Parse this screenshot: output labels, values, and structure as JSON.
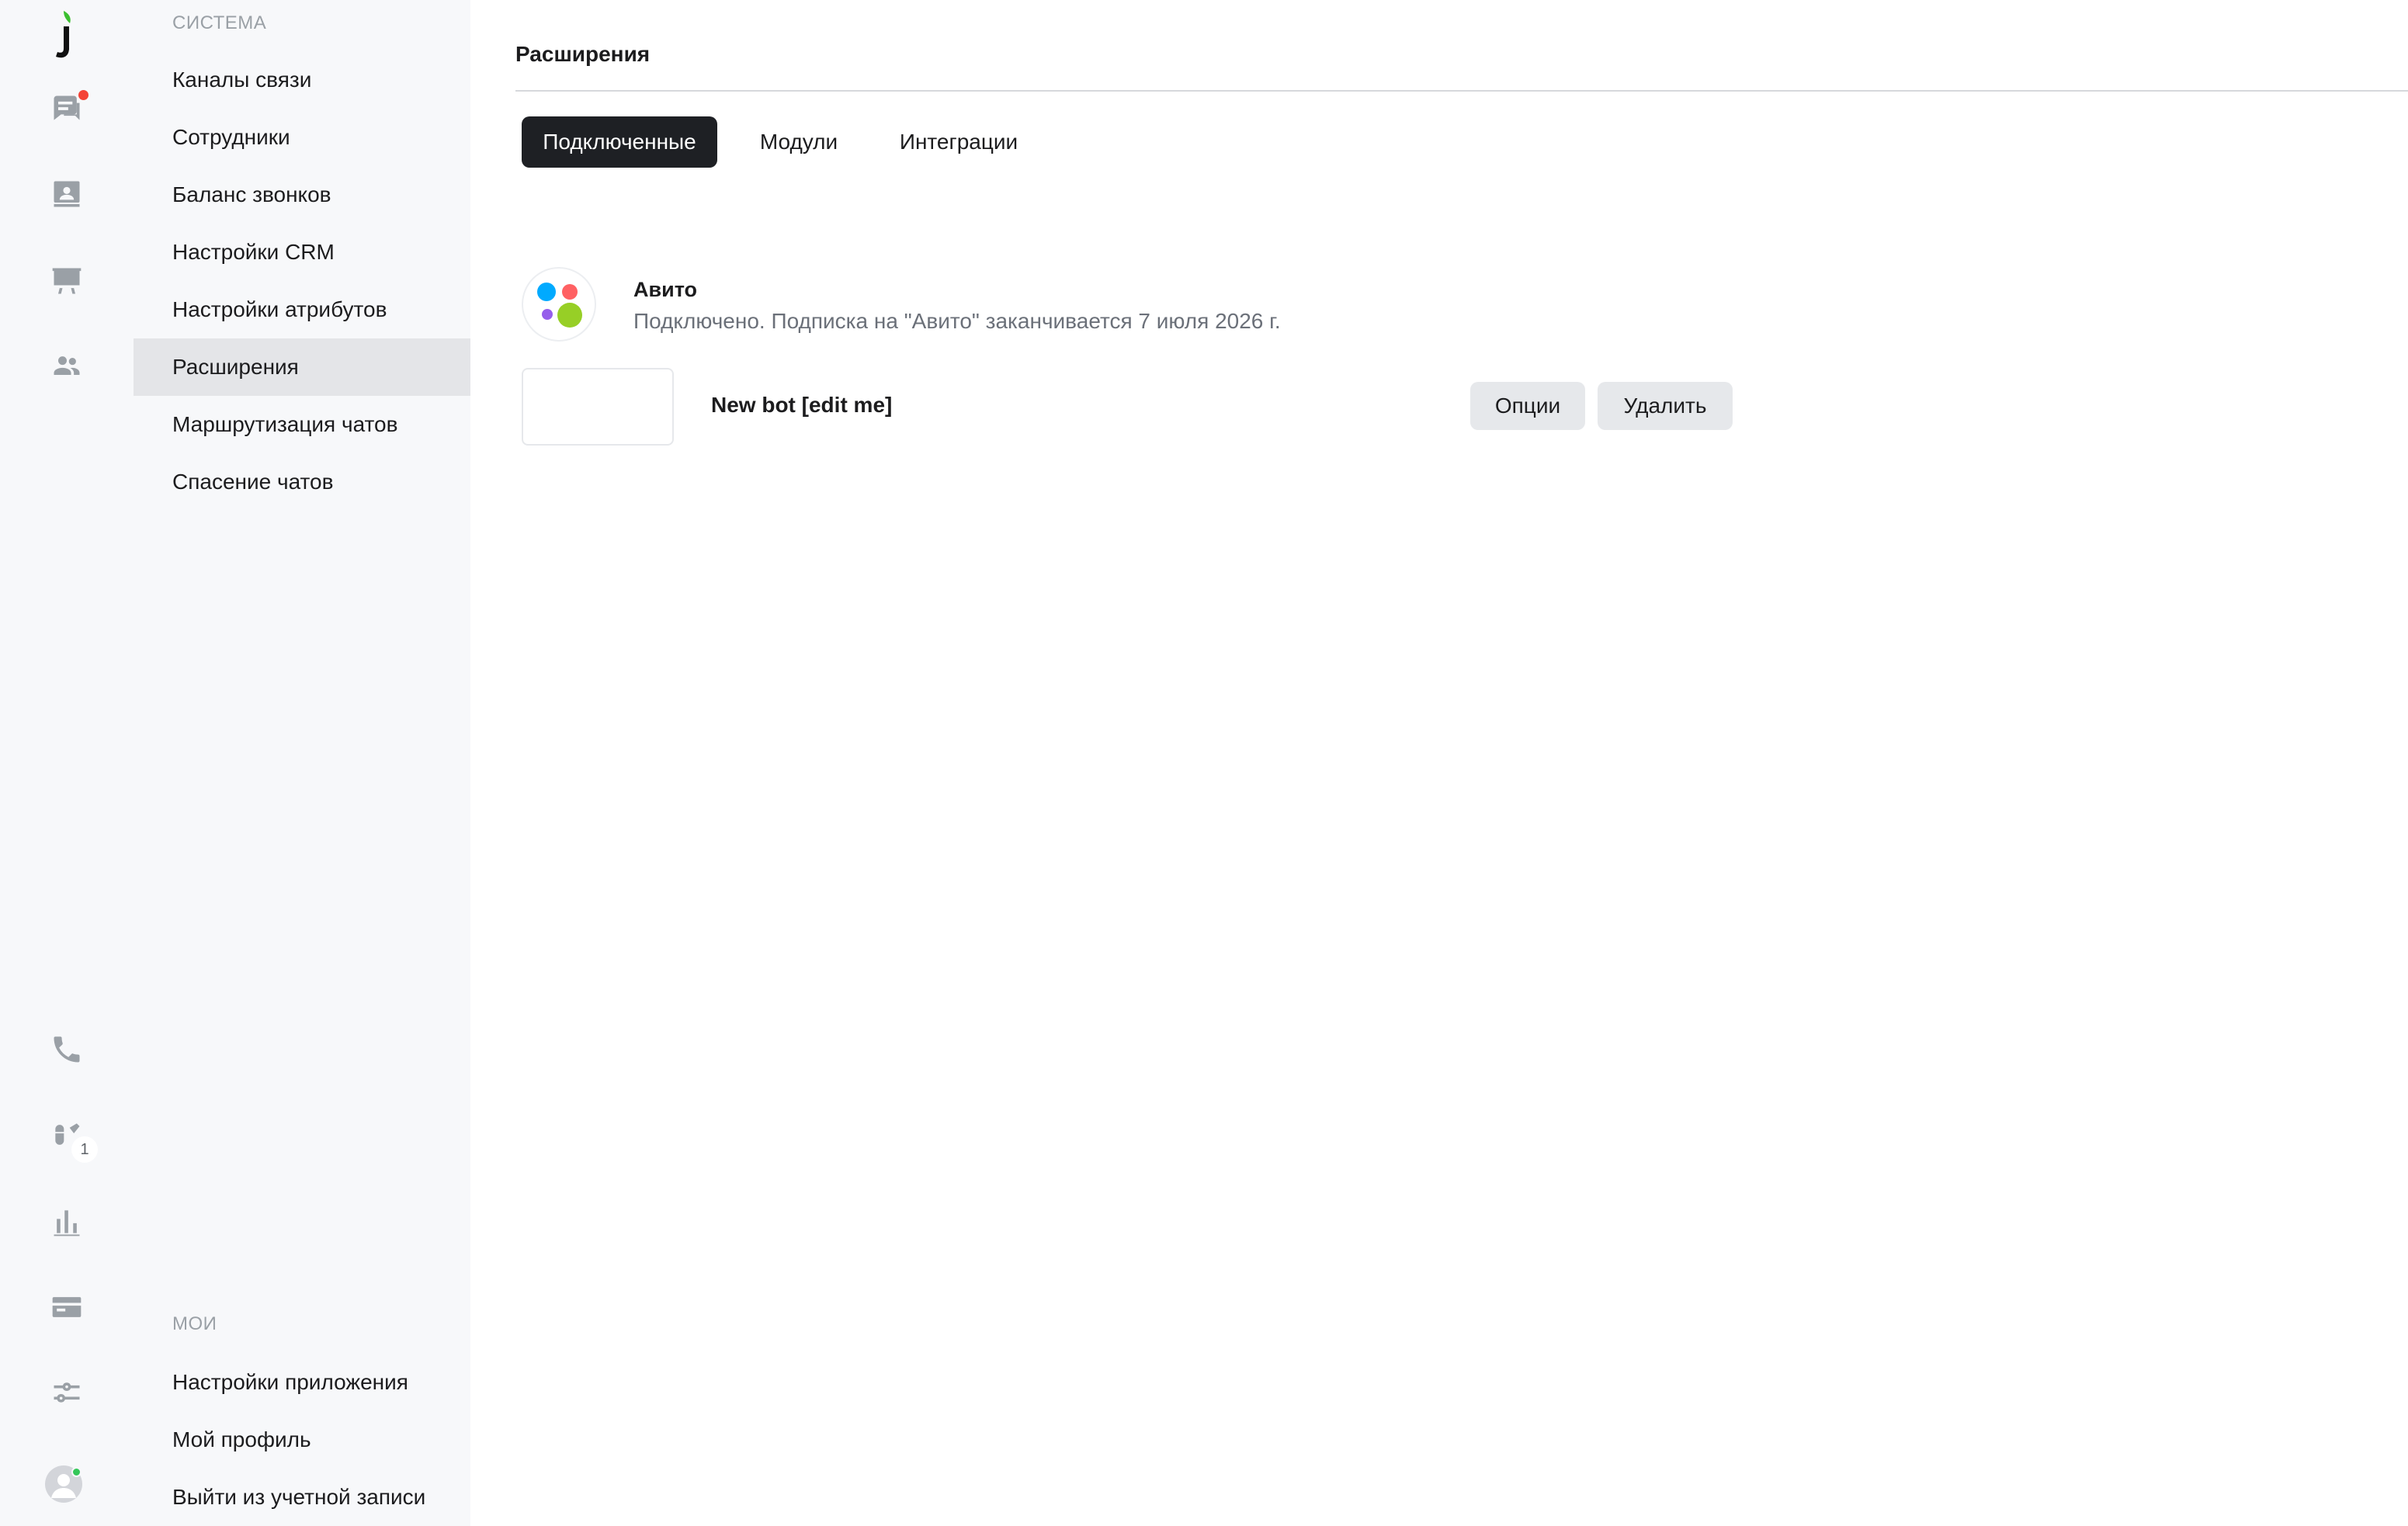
{
  "rail": {
    "top_icons": [
      "chat-icon",
      "contacts-icon",
      "presentation-icon",
      "team-icon"
    ],
    "bottom_icons": [
      "phone-icon",
      "bots-icon",
      "bar-chart-icon",
      "card-icon",
      "sliders-icon"
    ],
    "bots_count": "1"
  },
  "menu": {
    "system_heading": "СИСТЕМА",
    "system_items": [
      {
        "label": "Каналы связи"
      },
      {
        "label": "Сотрудники"
      },
      {
        "label": "Баланс звонков"
      },
      {
        "label": "Настройки CRM"
      },
      {
        "label": "Настройки атрибутов"
      },
      {
        "label": "Расширения",
        "active": true
      },
      {
        "label": "Маршрутизация чатов"
      },
      {
        "label": "Спасение чатов"
      }
    ],
    "my_heading": "МОИ",
    "my_items": [
      {
        "label": "Настройки приложения"
      },
      {
        "label": "Мой профиль"
      },
      {
        "label": "Выйти из учетной записи"
      }
    ]
  },
  "main": {
    "title": "Расширения",
    "tabs": [
      {
        "label": "Подключенные",
        "active": true
      },
      {
        "label": "Модули"
      },
      {
        "label": "Интеграции"
      }
    ],
    "extensions": [
      {
        "name": "Авито",
        "status": "Подключено. Подписка на \"Авито\" заканчивается 7 июля 2026 г.",
        "logo": "avito-logo"
      },
      {
        "name": "New bot [edit me]",
        "options_label": "Опции",
        "delete_label": "Удалить"
      }
    ]
  },
  "colors": {
    "accent_dark": "#1e2024",
    "notification": "#f44336",
    "online": "#34c759",
    "avito_blue": "#0af",
    "avito_red": "#ff6163",
    "avito_purple": "#965eeb",
    "avito_green": "#97cf26"
  }
}
